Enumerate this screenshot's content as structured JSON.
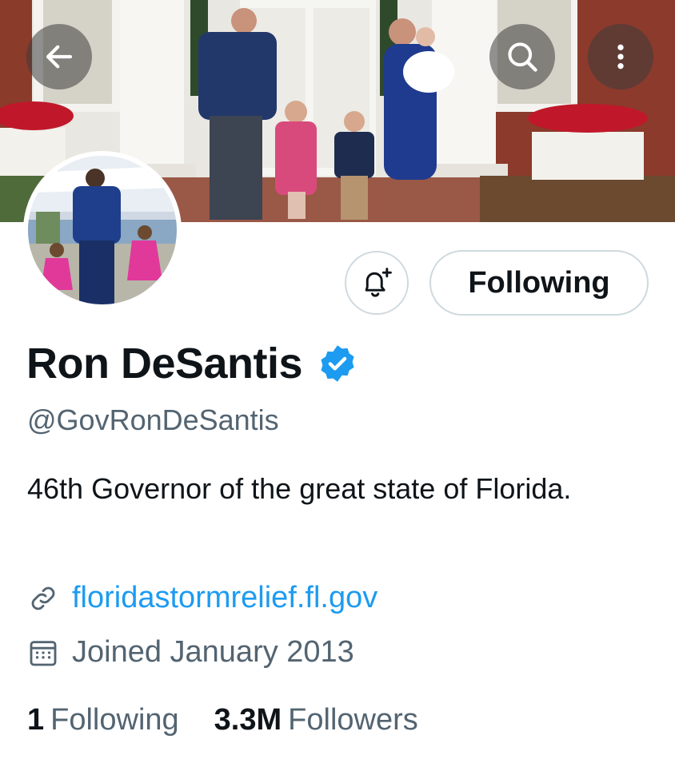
{
  "header": {
    "back_icon": "arrow-left-icon",
    "search_icon": "search-icon",
    "more_icon": "more-vertical-icon"
  },
  "profile": {
    "name": "Ron DeSantis",
    "verified": true,
    "handle": "@GovRonDeSantis",
    "bio": "46th Governor of the great state of Florida.",
    "website": "floridastormrelief.fl.gov",
    "joined": "Joined January 2013"
  },
  "actions": {
    "notify_icon": "bell-plus-icon",
    "follow_label": "Following"
  },
  "stats": {
    "following_count": "1",
    "following_label": "Following",
    "followers_count": "3.3M",
    "followers_label": "Followers"
  },
  "colors": {
    "accent": "#1d9bf0",
    "secondary_text": "#536471",
    "primary_text": "#0f1419",
    "border": "#cfd9de"
  }
}
